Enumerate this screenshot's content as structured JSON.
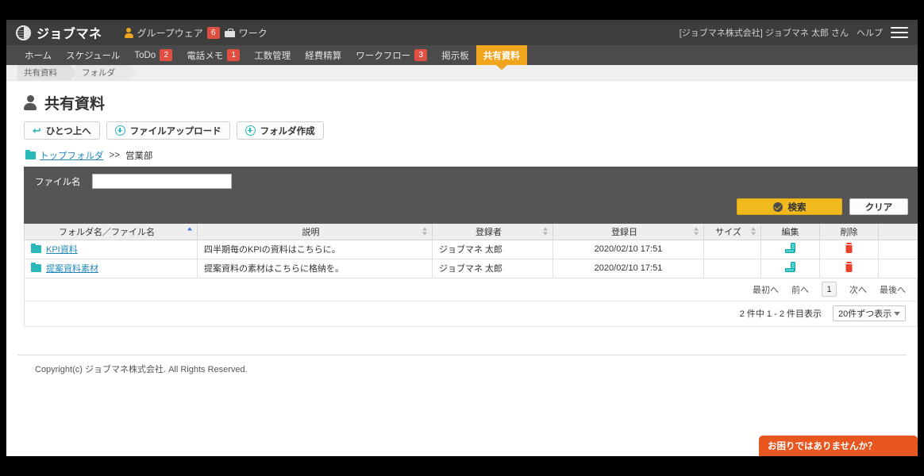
{
  "header": {
    "logo_text": "ジョブマネ",
    "nav": [
      {
        "label": "グループウェア",
        "icon": "person-icon",
        "badge": "6"
      },
      {
        "label": "ワーク",
        "icon": "briefcase-icon",
        "badge": ""
      }
    ],
    "account_text": "[ジョブマネ株式会社] ジョブマネ 太郎 さん",
    "help_label": "ヘルプ",
    "menu_icon": "hamburger-icon"
  },
  "mainnav": [
    {
      "label": "ホーム",
      "badge": "",
      "active": false
    },
    {
      "label": "スケジュール",
      "badge": "",
      "active": false
    },
    {
      "label": "ToDo",
      "badge": "2",
      "active": false
    },
    {
      "label": "電話メモ",
      "badge": "1",
      "active": false
    },
    {
      "label": "工数管理",
      "badge": "",
      "active": false
    },
    {
      "label": "経費精算",
      "badge": "",
      "active": false
    },
    {
      "label": "ワークフロー",
      "badge": "3",
      "active": false
    },
    {
      "label": "掲示板",
      "badge": "",
      "active": false
    },
    {
      "label": "共有資料",
      "badge": "",
      "active": true
    }
  ],
  "breadcrumb": [
    "共有資料",
    "フォルダ"
  ],
  "page": {
    "title": "共有資料",
    "buttons": [
      {
        "label": "ひとつ上へ",
        "icon": "arrow-up-icon"
      },
      {
        "label": "ファイルアップロード",
        "icon": "plus-circle-icon"
      },
      {
        "label": "フォルダ作成",
        "icon": "plus-circle-icon"
      }
    ]
  },
  "path": {
    "folder_icon": "folder-icon",
    "root_label": "トップフォルダ",
    "separator": ">>",
    "current_label": "営業部"
  },
  "search": {
    "field_label": "ファイル名",
    "field_value": "",
    "field_placeholder": "",
    "search_label": "検索",
    "clear_label": "クリア"
  },
  "table": {
    "columns": [
      {
        "label": "フォルダ名／ファイル名",
        "sort": "asc"
      },
      {
        "label": "説明",
        "sort": "none"
      },
      {
        "label": "登録者",
        "sort": "none"
      },
      {
        "label": "登録日",
        "sort": "none"
      },
      {
        "label": "サイズ",
        "sort": "none"
      },
      {
        "label": "編集",
        "sort": null
      },
      {
        "label": "削除",
        "sort": null
      }
    ],
    "rows": [
      {
        "name": "KPI資料",
        "description": "四半期毎のKPIの資料はこちらに。",
        "author": "ジョブマネ 太郎",
        "date": "2020/02/10 17:51",
        "size": "",
        "edit_icon": "pencil-icon",
        "delete_icon": "trash-icon"
      },
      {
        "name": "提案資料素材",
        "description": "提案資料の素材はこちらに格納を。",
        "author": "ジョブマネ 太郎",
        "date": "2020/02/10 17:51",
        "size": "",
        "edit_icon": "pencil-icon",
        "delete_icon": "trash-icon"
      }
    ]
  },
  "pagination": {
    "first": "最初へ",
    "prev": "前へ",
    "current_page": "1",
    "next": "次へ",
    "last": "最後へ",
    "count_text": "2 件中 1 - 2 件目表示",
    "per_page": "20件ずつ表示"
  },
  "footer": {
    "copyright": "Copyright(c) ジョブマネ株式会社. All Rights Reserved."
  },
  "help_widget": {
    "label": "お困りではありませんか？"
  },
  "colors": {
    "accent_orange": "#f0a51e",
    "teal": "#2ab9b9",
    "link_blue": "#2288bb",
    "badge_red": "#e04f41",
    "search_yellow": "#f0b91e",
    "widget_orange": "#e8561f",
    "dark_bar": "#3d3d3d"
  }
}
